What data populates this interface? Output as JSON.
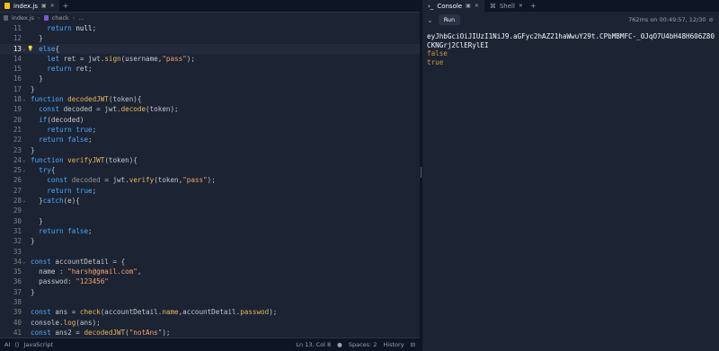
{
  "editor": {
    "tab": {
      "label": "index.js"
    },
    "breadcrumb": {
      "file": "index.js",
      "symbol": "check",
      "more": "..."
    },
    "lines": [
      {
        "n": "11",
        "parts": [
          [
            "p",
            "    "
          ],
          [
            "k",
            "return"
          ],
          [
            "p",
            " "
          ],
          [
            "v",
            "null"
          ],
          [
            "p",
            ";"
          ]
        ]
      },
      {
        "n": "12",
        "parts": [
          [
            "p",
            "  }"
          ]
        ]
      },
      {
        "n": "13",
        "parts": [
          [
            "p",
            "  "
          ],
          [
            "k",
            "else"
          ],
          [
            "p",
            "{"
          ]
        ],
        "current": true,
        "fold": true,
        "bulb": true
      },
      {
        "n": "14",
        "parts": [
          [
            "p",
            "    "
          ],
          [
            "k",
            "let"
          ],
          [
            "p",
            " ret = jwt."
          ],
          [
            "f",
            "sign"
          ],
          [
            "p",
            "(username,"
          ],
          [
            "s",
            "\"pass\""
          ],
          [
            "p",
            ");"
          ]
        ]
      },
      {
        "n": "15",
        "parts": [
          [
            "p",
            "    "
          ],
          [
            "k",
            "return"
          ],
          [
            "p",
            " ret;"
          ]
        ]
      },
      {
        "n": "16",
        "parts": [
          [
            "p",
            "  }"
          ]
        ]
      },
      {
        "n": "17",
        "parts": [
          [
            "p",
            "}"
          ]
        ]
      },
      {
        "n": "18",
        "parts": [
          [
            "k",
            "function"
          ],
          [
            "p",
            " "
          ],
          [
            "f",
            "decodedJWT"
          ],
          [
            "p",
            "(token){"
          ]
        ],
        "fold": true
      },
      {
        "n": "19",
        "parts": [
          [
            "p",
            "  "
          ],
          [
            "k",
            "const"
          ],
          [
            "p",
            " decoded = jwt."
          ],
          [
            "f",
            "decode"
          ],
          [
            "p",
            "(token);"
          ]
        ]
      },
      {
        "n": "20",
        "parts": [
          [
            "p",
            "  "
          ],
          [
            "k",
            "if"
          ],
          [
            "p",
            "(decoded)"
          ]
        ]
      },
      {
        "n": "21",
        "parts": [
          [
            "p",
            "    "
          ],
          [
            "k",
            "return"
          ],
          [
            "p",
            " "
          ],
          [
            "k",
            "true"
          ],
          [
            "p",
            ";"
          ]
        ]
      },
      {
        "n": "22",
        "parts": [
          [
            "p",
            "  "
          ],
          [
            "k",
            "return"
          ],
          [
            "p",
            " "
          ],
          [
            "k",
            "false"
          ],
          [
            "p",
            ";"
          ]
        ]
      },
      {
        "n": "23",
        "parts": [
          [
            "p",
            "}"
          ]
        ]
      },
      {
        "n": "24",
        "parts": [
          [
            "k",
            "function"
          ],
          [
            "p",
            " "
          ],
          [
            "f",
            "verifyJWT"
          ],
          [
            "p",
            "(token){"
          ]
        ],
        "fold": true
      },
      {
        "n": "25",
        "parts": [
          [
            "p",
            "  "
          ],
          [
            "k",
            "try"
          ],
          [
            "p",
            "{"
          ]
        ],
        "fold": true
      },
      {
        "n": "26",
        "parts": [
          [
            "p",
            "    "
          ],
          [
            "k",
            "const"
          ],
          [
            "p",
            " "
          ],
          [
            "d",
            "decoded"
          ],
          [
            "p",
            " = jwt."
          ],
          [
            "f",
            "verify"
          ],
          [
            "p",
            "(token,"
          ],
          [
            "s",
            "\"pass\""
          ],
          [
            "p",
            ");"
          ]
        ]
      },
      {
        "n": "27",
        "parts": [
          [
            "p",
            "    "
          ],
          [
            "k",
            "return"
          ],
          [
            "p",
            " "
          ],
          [
            "k",
            "true"
          ],
          [
            "p",
            ";"
          ]
        ]
      },
      {
        "n": "28",
        "parts": [
          [
            "p",
            "  }"
          ],
          [
            "k",
            "catch"
          ],
          [
            "p",
            "(e){"
          ]
        ],
        "fold": true
      },
      {
        "n": "29",
        "parts": [
          [
            "p",
            ""
          ]
        ]
      },
      {
        "n": "30",
        "parts": [
          [
            "p",
            "  }"
          ]
        ]
      },
      {
        "n": "31",
        "parts": [
          [
            "p",
            "  "
          ],
          [
            "k",
            "return"
          ],
          [
            "p",
            " "
          ],
          [
            "k",
            "false"
          ],
          [
            "p",
            ";"
          ]
        ]
      },
      {
        "n": "32",
        "parts": [
          [
            "p",
            "}"
          ]
        ]
      },
      {
        "n": "33",
        "parts": [
          [
            "p",
            ""
          ]
        ]
      },
      {
        "n": "34",
        "parts": [
          [
            "k",
            "const"
          ],
          [
            "p",
            " accountDetail = {"
          ]
        ],
        "fold": true
      },
      {
        "n": "35",
        "parts": [
          [
            "p",
            "  name : "
          ],
          [
            "s",
            "\"harsh@gmail.com\""
          ],
          [
            "p",
            ","
          ]
        ]
      },
      {
        "n": "36",
        "parts": [
          [
            "p",
            "  passwod: "
          ],
          [
            "s",
            "\"123456\""
          ]
        ]
      },
      {
        "n": "37",
        "parts": [
          [
            "p",
            "}"
          ]
        ]
      },
      {
        "n": "38",
        "parts": [
          [
            "p",
            ""
          ]
        ]
      },
      {
        "n": "39",
        "parts": [
          [
            "k",
            "const"
          ],
          [
            "p",
            " ans = "
          ],
          [
            "f",
            "check"
          ],
          [
            "p",
            "(accountDetail."
          ],
          [
            "f",
            "name"
          ],
          [
            "p",
            ",accountDetail."
          ],
          [
            "f",
            "passwod"
          ],
          [
            "p",
            ");"
          ]
        ]
      },
      {
        "n": "40",
        "parts": [
          [
            "p",
            "console."
          ],
          [
            "f",
            "log"
          ],
          [
            "p",
            "(ans);"
          ]
        ]
      },
      {
        "n": "41",
        "parts": [
          [
            "k",
            "const"
          ],
          [
            "p",
            " ans2 = "
          ],
          [
            "f",
            "decodedJWT"
          ],
          [
            "p",
            "("
          ],
          [
            "s",
            "\"notAns\""
          ],
          [
            "p",
            ");"
          ]
        ]
      }
    ]
  },
  "statusbar": {
    "ai": "AI",
    "language": "JavaScript",
    "position": "Ln 13, Col 8",
    "spaces": "Spaces: 2",
    "history": "History"
  },
  "console": {
    "tabs": [
      {
        "label": "Console",
        "active": true
      },
      {
        "label": "Shell",
        "active": false
      }
    ],
    "run_label": "Run",
    "run_info": "762ms on 00:49:57, 12/30",
    "output": {
      "token": "eyJhbGciOiJIUzI1NiJ9.aGFyc2hAZ21haWwuY29t.CPbMBMFC-_0JqO7U4bH48H606Z80CKNGrj2ClERylEI",
      "line2": "false",
      "line3": "true"
    }
  },
  "colors": {
    "keyword": "#4aa9ff",
    "function": "#e9b857",
    "string": "#f5a46c",
    "background": "#1c2333"
  }
}
